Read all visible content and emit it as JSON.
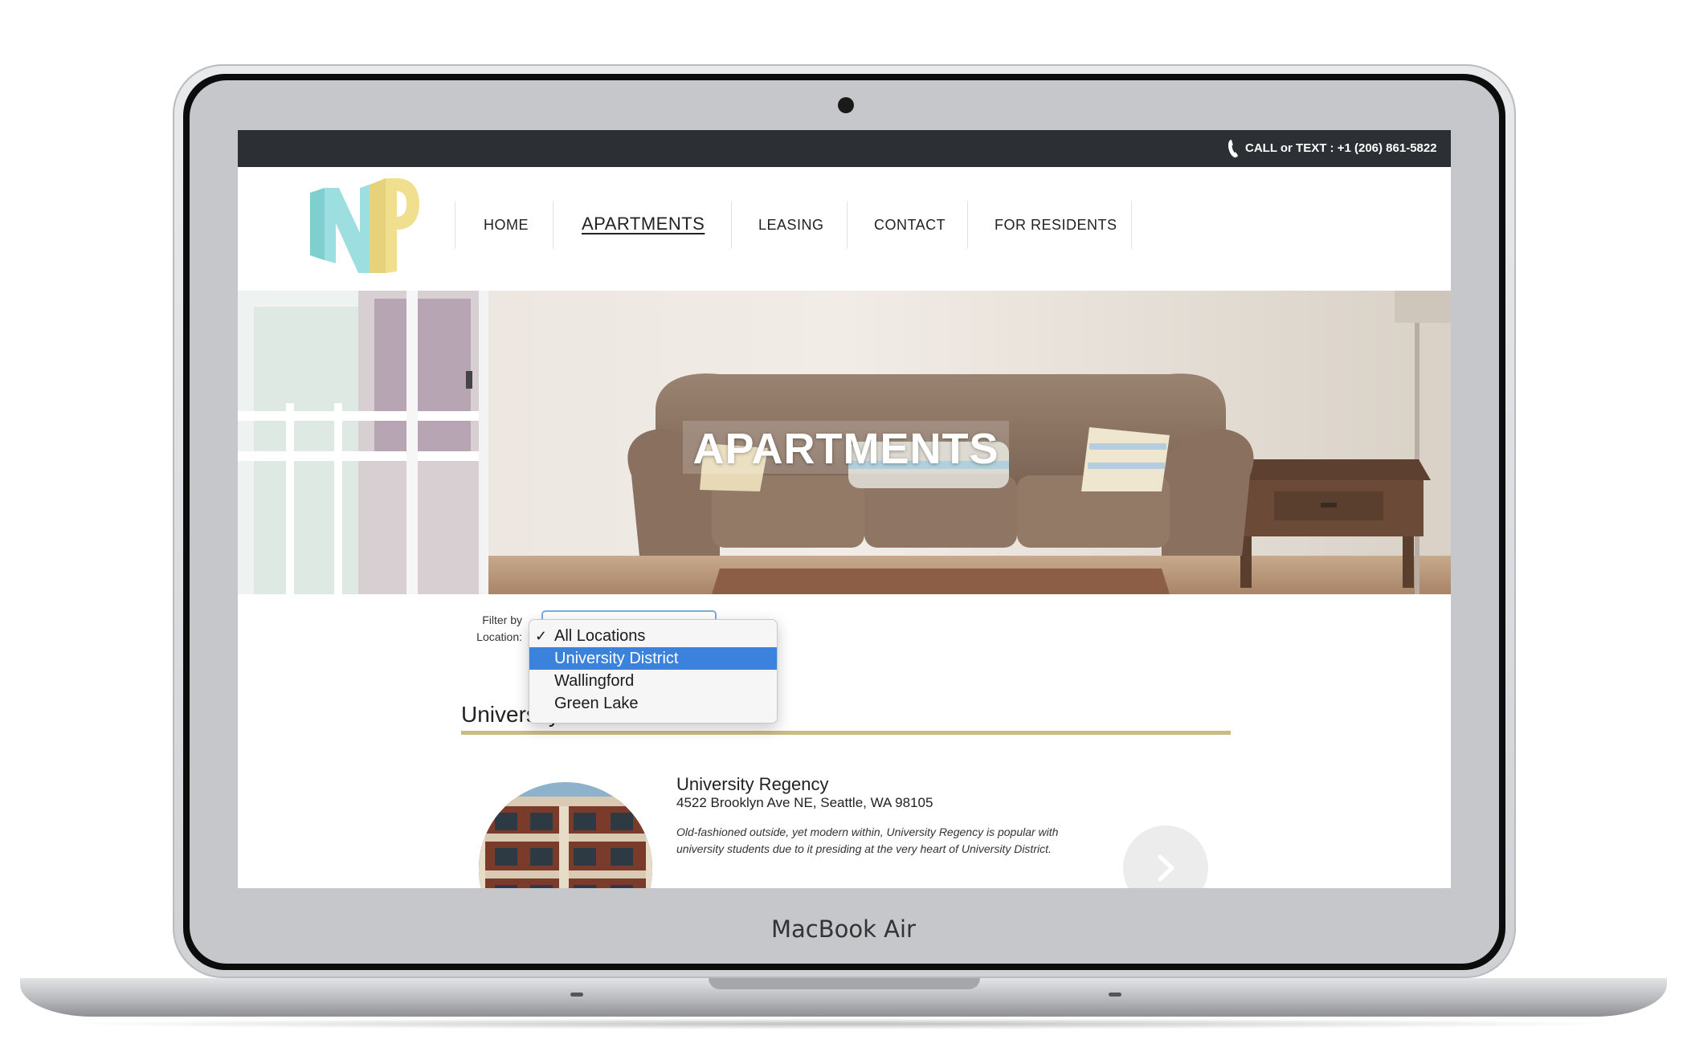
{
  "device": {
    "label": "MacBook Air"
  },
  "topbar": {
    "contact_text": "CALL or TEXT : +1 (206) 861-5822",
    "phone_icon": "phone-icon"
  },
  "logo": {
    "letters": "NP",
    "colors": {
      "n": "#9ddfe0",
      "p": "#efdf8f"
    }
  },
  "nav": {
    "items": [
      {
        "label": "HOME",
        "active": false
      },
      {
        "label": "APARTMENTS",
        "active": true
      },
      {
        "label": "LEASING",
        "active": false
      },
      {
        "label": "CONTACT",
        "active": false
      },
      {
        "label": "FOR RESIDENTS",
        "active": false
      }
    ]
  },
  "hero": {
    "title": "APARTMENTS"
  },
  "filter": {
    "label_line1": "Filter by",
    "label_line2": "Location:",
    "options": [
      {
        "label": "All Locations",
        "checked": true,
        "highlighted": false
      },
      {
        "label": "University District",
        "checked": false,
        "highlighted": true
      },
      {
        "label": "Wallingford",
        "checked": false,
        "highlighted": false
      },
      {
        "label": "Green Lake",
        "checked": false,
        "highlighted": false
      }
    ],
    "check_glyph": "✓"
  },
  "section": {
    "heading": "University District",
    "accent_color": "#c9bb82"
  },
  "property": {
    "name": "University Regency",
    "address": "4522 Brooklyn Ave NE, Seattle, WA 98105",
    "description": "Old-fashioned outside, yet modern within, University Regency is popular with university students due to it presiding at the very heart of University District.",
    "next_icon": "chevron-right-icon"
  }
}
